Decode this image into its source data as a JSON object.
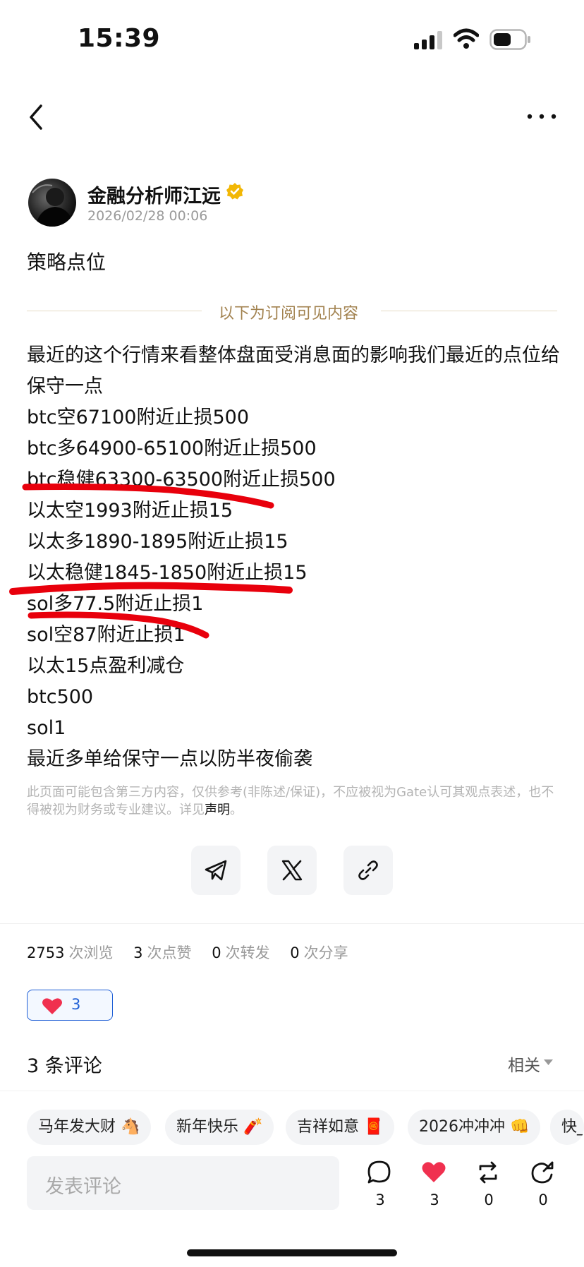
{
  "status_bar": {
    "time": "15:39"
  },
  "post": {
    "author": "金融分析师江远",
    "time": "2026/02/28 00:06",
    "title": "策略点位",
    "subscriber_divider": "以下为订阅可见内容",
    "lines": [
      "最近的这个行情来看整体盘面受消息面的影响我们最近的点位给保守一点",
      "btc空67100附近止损500",
      "btc多64900-65100附近止损500",
      "btc稳健63300-63500附近止损500",
      "以太空1993附近止损15",
      "以太多1890-1895附近止损15",
      "以太稳健1845-1850附近止损15",
      "sol多77.5附近止损1",
      "sol空87附近止损1",
      "以太15点盈利减仓",
      "btc500",
      "sol1",
      "最近多单给保守一点以防半夜偷袭"
    ],
    "disclaimer": "此页面可能包含第三方内容，仅供参考(非陈述/保证)，不应被视为Gate认可其观点表述，也不得被视为财务或专业建议。详见",
    "disclaimer_link": "声明",
    "disclaimer_end": "。"
  },
  "share_icons": [
    "telegram-icon",
    "x-icon",
    "link-icon"
  ],
  "stats": {
    "views": "2753",
    "views_label": "次浏览",
    "likes": "3",
    "likes_label": "次点赞",
    "reposts": "0",
    "reposts_label": "次转发",
    "shares": "0",
    "shares_label": "次分享"
  },
  "like_chip": {
    "count": "3",
    "icon": "heart-icon",
    "color": "#f0304f"
  },
  "comments": {
    "title": "3 条评论",
    "sort_label": "相关"
  },
  "quick_replies": [
    "马年发大财 🐴",
    "新年快乐 🧨",
    "吉祥如意 🧧",
    "2026冲冲冲 👊",
    "快_"
  ],
  "bottom_bar": {
    "placeholder": "发表评论",
    "comment_count": "3",
    "like_count": "3",
    "repost_count": "0",
    "share_count": "0"
  },
  "colors": {
    "accent_blue": "#1f5fd6",
    "heart_red": "#f0304f",
    "verified_gold": "#f2b705",
    "divider_gold": "#a2824f",
    "scribble_red": "#e8000c"
  }
}
